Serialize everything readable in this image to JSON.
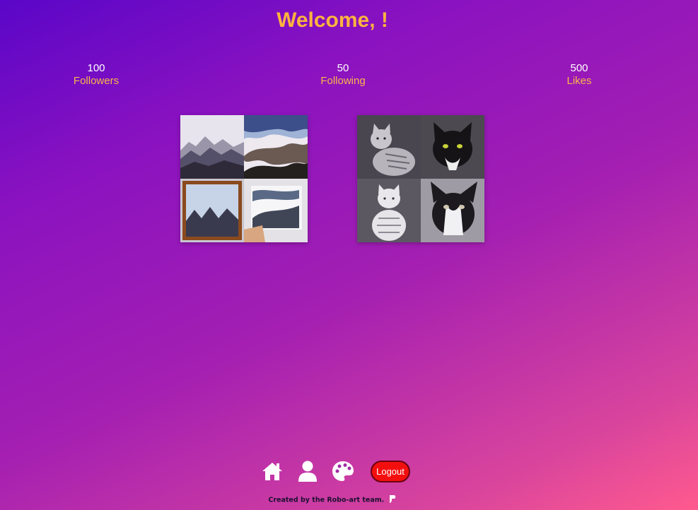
{
  "header": {
    "welcome": "Welcome, !"
  },
  "stats": [
    {
      "value": "100",
      "label": "Followers"
    },
    {
      "value": "50",
      "label": "Following"
    },
    {
      "value": "500",
      "label": "Likes"
    }
  ],
  "gallery": [
    {
      "subject": "mountains"
    },
    {
      "subject": "cats"
    }
  ],
  "nav": {
    "icons": [
      "home-icon",
      "user-icon",
      "palette-icon"
    ],
    "logout_label": "Logout"
  },
  "footer": {
    "credit": "Created by the Robo-art team."
  },
  "colors": {
    "accent": "#fdb33f",
    "logout": "#f40f0f",
    "gradient_start": "#5a06c8",
    "gradient_end": "#ff5a8e"
  }
}
